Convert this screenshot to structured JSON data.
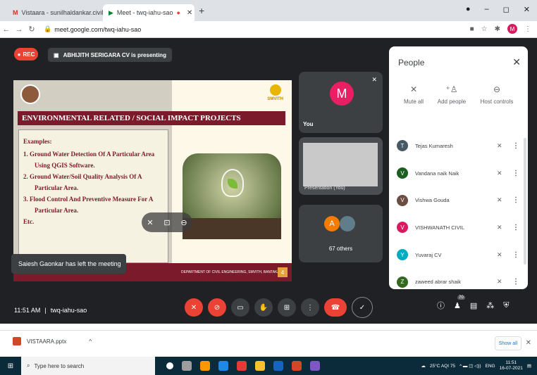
{
  "tabs": [
    {
      "label": "Vistaara - sunilhaldankar.civil@..."
    },
    {
      "label": "Meet - twq-iahu-sao"
    }
  ],
  "address": {
    "url": "meet.google.com/twq-iahu-sao"
  },
  "meeting": {
    "rec_label": "REC",
    "presenting_text": "ABHIJITH SERIGARA CV is presenting",
    "slide": {
      "college": "SMVITH",
      "header": "ENVIRONMENTAL RELATED / SOCIAL IMPACT PROJECTS",
      "examples_title": "Examples:",
      "items": [
        "1. Ground Water Detection Of A Particular Area",
        "Using QGIS Software.",
        "2. Ground Water/Soil Quality Analysis Of A",
        "Particular Area.",
        "3. Flood Control And Preventive Measure For A",
        "Particular Area.",
        "Etc."
      ],
      "footer": "DEPARTMENT OF CIVIL ENGINEERING, SMVITH, BANTAKAL",
      "page": "4"
    },
    "toast": "Saiesh Gaonkar has left the meeting",
    "you_tile": {
      "initial": "M",
      "label": "You"
    },
    "presentation_tile": {
      "label": "Presentation (You)"
    },
    "others_tile": {
      "initial": "A",
      "label": "67 others"
    },
    "time": "11:51 AM",
    "meeting_code": "twq-iahu-sao",
    "participant_count": "70"
  },
  "people_panel": {
    "title": "People",
    "actions": [
      {
        "label": "Mute all"
      },
      {
        "label": "Add people"
      },
      {
        "label": "Host controls"
      }
    ],
    "participants": [
      {
        "initial": "T",
        "name": "Tejas Kumaresh",
        "color": "#455a64"
      },
      {
        "initial": "V",
        "name": "Vandana naik Naik",
        "color": "#1b5e20"
      },
      {
        "initial": "V",
        "name": "Vishwa Gouda",
        "color": "#6d4c41"
      },
      {
        "initial": "V",
        "name": "VISHWANATH CIVIL",
        "color": "#d81b60"
      },
      {
        "initial": "Y",
        "name": "Yuvaraj CV",
        "color": "#00acc1"
      },
      {
        "initial": "Z",
        "name": "zaweed abrar shaik",
        "color": "#33691e"
      }
    ]
  },
  "download": {
    "file": "VISTAARA.pptx",
    "show_all": "Show all"
  },
  "taskbar": {
    "search_placeholder": "Type here to search",
    "weather": "25°C AQI 75",
    "lang": "ENG",
    "time": "11:51",
    "date": "16-07-2021"
  }
}
